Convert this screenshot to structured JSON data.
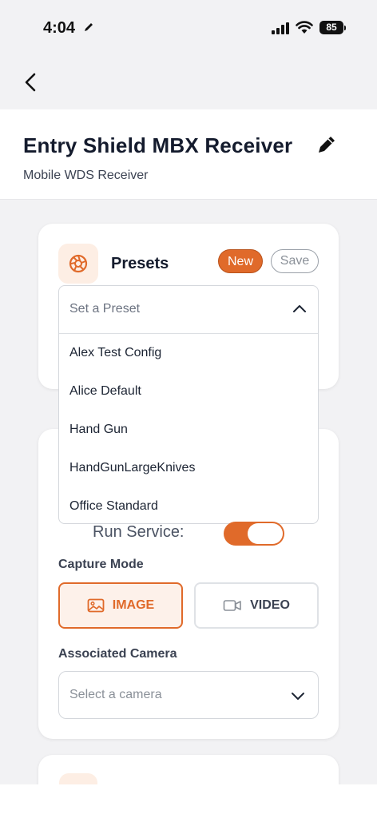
{
  "status_bar": {
    "time": "4:04",
    "battery": "85"
  },
  "header": {
    "title": "Entry Shield MBX Receiver",
    "subtitle": "Mobile WDS Receiver"
  },
  "presets": {
    "title": "Presets",
    "new_label": "New",
    "save_label": "Save",
    "placeholder": "Set a Preset",
    "options": [
      "Alex Test Config",
      "Alice Default",
      "Hand Gun",
      "HandGunLargeKnives",
      "Office Standard"
    ]
  },
  "service": {
    "run_label": "Run Service:",
    "run_enabled": true,
    "capture_mode_label": "Capture Mode",
    "image_label": "IMAGE",
    "video_label": "VIDEO",
    "selected_mode": "IMAGE",
    "camera_label": "Associated Camera",
    "camera_placeholder": "Select a camera"
  },
  "colors": {
    "accent": "#e06a2a",
    "accent_light": "#fdeee4"
  }
}
